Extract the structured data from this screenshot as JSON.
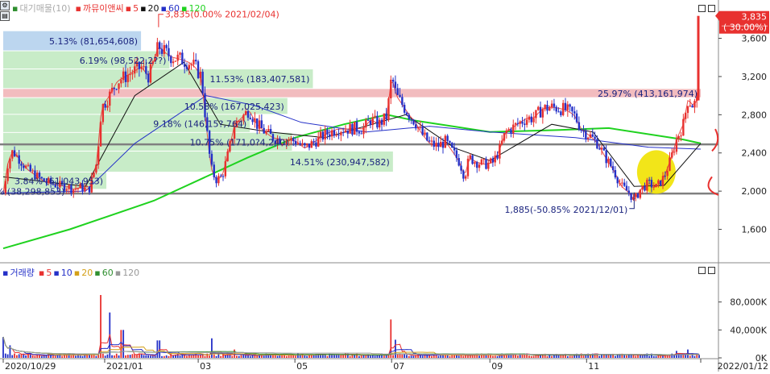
{
  "price_panel": {
    "legend": {
      "series_label": "대기매물(10)",
      "stock_name": "까뮤이앤씨",
      "ma_periods": [
        "5",
        "20",
        "60",
        "120"
      ]
    },
    "current_price_label": "3,835",
    "current_change_label": "( 30.00%)",
    "high_annotation": "3,835(0.00% 2021/02/04)",
    "low_annotation": "1,885(-50.85% 2021/12/01)"
  },
  "volume_panel": {
    "legend": {
      "series_label": "거래량",
      "ma_periods": [
        "5",
        "10",
        "20",
        "60",
        "120"
      ]
    }
  },
  "chart_data": [
    {
      "type": "candlestick",
      "title": "까뮤이앤씨",
      "y_ticks": [
        "3,600",
        "3,200",
        "2,800",
        "2,400",
        "2,000",
        "1,600"
      ],
      "y_tick_values": [
        3600,
        3200,
        2800,
        2400,
        2000,
        1600
      ],
      "ylim": [
        1250,
        3900
      ],
      "x_ticks": [
        "2020/10/29",
        "2021/01",
        "03",
        "05",
        "07",
        "09",
        "11",
        "2022/01/12"
      ],
      "x_start": "2020-10-29",
      "x_end": "2022-01-12",
      "x_tick_dates": [
        "2020-10-29",
        "2021-01-01",
        "2021-03-01",
        "2021-05-01",
        "2021-07-01",
        "2021-09-01",
        "2021-11-01",
        "2022-01-12"
      ],
      "horizontal_lines": [
        2490,
        1975
      ],
      "current_price": 3835,
      "current_change_pct": 30.0,
      "high": {
        "date": "2021-02-04",
        "price": 3835,
        "change_pct": 0.0
      },
      "low": {
        "date": "2021-12-01",
        "price": 1885,
        "change_pct": -50.85
      },
      "close_path": [
        [
          "2020-10-29",
          1980
        ],
        [
          "2020-11-01",
          2300
        ],
        [
          "2020-11-04",
          2420
        ],
        [
          "2020-11-09",
          2320
        ],
        [
          "2020-11-13",
          2230
        ],
        [
          "2020-11-18",
          2170
        ],
        [
          "2020-11-23",
          2110
        ],
        [
          "2020-11-28",
          2080
        ],
        [
          "2020-12-03",
          2060
        ],
        [
          "2020-12-08",
          2050
        ],
        [
          "2020-12-12",
          2020
        ],
        [
          "2020-12-17",
          2040
        ],
        [
          "2020-12-22",
          2010
        ],
        [
          "2020-12-27",
          2300
        ],
        [
          "2020-12-30",
          2870
        ],
        [
          "2021-01-04",
          3000
        ],
        [
          "2021-01-09",
          3150
        ],
        [
          "2021-01-14",
          3200
        ],
        [
          "2021-01-19",
          3250
        ],
        [
          "2021-01-24",
          3300
        ],
        [
          "2021-01-29",
          3200
        ],
        [
          "2021-02-04",
          3520
        ],
        [
          "2021-02-08",
          3450
        ],
        [
          "2021-02-13",
          3400
        ],
        [
          "2021-02-18",
          3380
        ],
        [
          "2021-02-23",
          3350
        ],
        [
          "2021-02-27",
          3300
        ],
        [
          "2021-03-03",
          3200
        ],
        [
          "2021-03-06",
          2700
        ],
        [
          "2021-03-09",
          2250
        ],
        [
          "2021-03-12",
          2120
        ],
        [
          "2021-03-16",
          2150
        ],
        [
          "2021-03-20",
          2400
        ],
        [
          "2021-03-24",
          2700
        ],
        [
          "2021-03-28",
          2760
        ],
        [
          "2021-04-02",
          2850
        ],
        [
          "2021-04-07",
          2700
        ],
        [
          "2021-04-12",
          2620
        ],
        [
          "2021-04-17",
          2560
        ],
        [
          "2021-04-22",
          2540
        ],
        [
          "2021-04-27",
          2540
        ],
        [
          "2021-05-02",
          2520
        ],
        [
          "2021-05-07",
          2450
        ],
        [
          "2021-05-12",
          2500
        ],
        [
          "2021-05-17",
          2560
        ],
        [
          "2021-05-22",
          2610
        ],
        [
          "2021-05-28",
          2650
        ],
        [
          "2021-06-03",
          2650
        ],
        [
          "2021-06-08",
          2660
        ],
        [
          "2021-06-13",
          2650
        ],
        [
          "2021-06-18",
          2750
        ],
        [
          "2021-06-23",
          2700
        ],
        [
          "2021-06-28",
          2780
        ],
        [
          "2021-07-01",
          3200
        ],
        [
          "2021-07-04",
          3000
        ],
        [
          "2021-07-08",
          2900
        ],
        [
          "2021-07-12",
          2800
        ],
        [
          "2021-07-16",
          2720
        ],
        [
          "2021-07-20",
          2600
        ],
        [
          "2021-07-25",
          2500
        ],
        [
          "2021-07-30",
          2470
        ],
        [
          "2021-08-04",
          2520
        ],
        [
          "2021-08-09",
          2400
        ],
        [
          "2021-08-13",
          2300
        ],
        [
          "2021-08-16",
          2150
        ],
        [
          "2021-08-19",
          2350
        ],
        [
          "2021-08-24",
          2300
        ],
        [
          "2021-08-29",
          2280
        ],
        [
          "2021-09-03",
          2300
        ],
        [
          "2021-09-07",
          2430
        ],
        [
          "2021-09-11",
          2620
        ],
        [
          "2021-09-15",
          2660
        ],
        [
          "2021-09-20",
          2720
        ],
        [
          "2021-09-24",
          2760
        ],
        [
          "2021-09-29",
          2770
        ],
        [
          "2021-10-04",
          2860
        ],
        [
          "2021-10-09",
          2880
        ],
        [
          "2021-10-14",
          2870
        ],
        [
          "2021-10-19",
          2850
        ],
        [
          "2021-10-24",
          2800
        ],
        [
          "2021-10-29",
          2640
        ],
        [
          "2021-11-03",
          2580
        ],
        [
          "2021-11-08",
          2500
        ],
        [
          "2021-11-13",
          2350
        ],
        [
          "2021-11-18",
          2220
        ],
        [
          "2021-11-23",
          2050
        ],
        [
          "2021-11-28",
          1980
        ],
        [
          "2021-12-01",
          1900
        ],
        [
          "2021-12-05",
          2020
        ],
        [
          "2021-12-10",
          2080
        ],
        [
          "2021-12-15",
          2040
        ],
        [
          "2021-12-20",
          2150
        ],
        [
          "2021-12-24",
          2330
        ],
        [
          "2021-12-28",
          2550
        ],
        [
          "2022-01-01",
          2700
        ],
        [
          "2022-01-04",
          2960
        ],
        [
          "2022-01-07",
          2900
        ],
        [
          "2022-01-10",
          2950
        ],
        [
          "2022-01-12",
          3835
        ]
      ],
      "ma120_path": [
        [
          "2020-10-29",
          1400
        ],
        [
          "2020-12-10",
          1600
        ],
        [
          "2021-02-01",
          1900
        ],
        [
          "2021-04-01",
          2350
        ],
        [
          "2021-05-01",
          2560
        ],
        [
          "2021-06-01",
          2700
        ],
        [
          "2021-06-28",
          2800
        ],
        [
          "2021-07-15",
          2740
        ],
        [
          "2021-09-01",
          2620
        ],
        [
          "2021-10-15",
          2640
        ],
        [
          "2021-11-15",
          2660
        ],
        [
          "2022-01-01",
          2540
        ],
        [
          "2022-01-12",
          2500
        ]
      ],
      "ma60_path": [
        [
          "2020-10-29",
          1980
        ],
        [
          "2020-12-20",
          2000
        ],
        [
          "2021-01-20",
          2500
        ],
        [
          "2021-03-06",
          3000
        ],
        [
          "2021-04-05",
          2900
        ],
        [
          "2021-05-05",
          2720
        ],
        [
          "2021-06-15",
          2620
        ],
        [
          "2021-07-25",
          2680
        ],
        [
          "2021-09-01",
          2620
        ],
        [
          "2021-10-25",
          2560
        ],
        [
          "2021-12-10",
          2460
        ],
        [
          "2022-01-12",
          2440
        ]
      ],
      "ma20_path": [
        [
          "2020-10-29",
          2150
        ],
        [
          "2020-12-20",
          2050
        ],
        [
          "2021-01-20",
          3000
        ],
        [
          "2021-02-20",
          3350
        ],
        [
          "2021-03-15",
          2700
        ],
        [
          "2021-04-15",
          2620
        ],
        [
          "2021-05-20",
          2560
        ],
        [
          "2021-07-10",
          2800
        ],
        [
          "2021-08-10",
          2450
        ],
        [
          "2021-09-01",
          2320
        ],
        [
          "2021-10-10",
          2700
        ],
        [
          "2021-11-05",
          2620
        ],
        [
          "2021-12-01",
          2050
        ],
        [
          "2021-12-20",
          2060
        ],
        [
          "2022-01-12",
          2500
        ]
      ],
      "volume_profile": [
        {
          "label": "5.13% (81,654,608)",
          "pct": 5.13
        },
        {
          "label": "6.19% (98,522,2??)",
          "pct": 6.19
        },
        {
          "label": "11.53% (183,407,581)",
          "pct": 11.53
        },
        {
          "label": "25.97% (413,161,974)",
          "pct": 25.97
        },
        {
          "label": "10.58% (167,025,423)",
          "pct": 10.58
        },
        {
          "label": "9.18% (146,15?,764)",
          "pct": 9.18
        },
        {
          "label": "10.75% (171,0?4,240)",
          "pct": 10.75
        },
        {
          "label": "14.51% (230,947,582)",
          "pct": 14.51
        },
        {
          "label": "3.84% (61,043,953)",
          "pct": 3.84
        },
        {
          "label": "2.41% (38,298,853)",
          "pct": 2.41
        }
      ],
      "volume_profile_bounds": [
        3675,
        3465,
        3275,
        3070,
        2975,
        2800,
        2610,
        2415,
        2195,
        2015,
        1980
      ],
      "highlight_zone": {
        "date": "2021-12-15",
        "price": 2200
      }
    },
    {
      "type": "bar",
      "title": "거래량",
      "y_ticks": [
        "80,000K",
        "40,000K",
        "0K"
      ],
      "y_tick_values": [
        80000,
        40000,
        0
      ],
      "ylim": [
        0,
        120000
      ],
      "volume_spikes": [
        [
          "2020-10-29",
          30000
        ],
        [
          "2020-11-02",
          18000
        ],
        [
          "2020-12-30",
          90000
        ],
        [
          "2021-01-04",
          65000
        ],
        [
          "2021-01-12",
          40000
        ],
        [
          "2021-02-04",
          25000
        ],
        [
          "2021-03-09",
          28000
        ],
        [
          "2021-03-24",
          12000
        ],
        [
          "2021-07-01",
          55000
        ],
        [
          "2021-07-04",
          26000
        ],
        [
          "2021-12-28",
          10000
        ],
        [
          "2022-01-04",
          12000
        ],
        [
          "2022-01-12",
          45000
        ]
      ]
    }
  ],
  "colors": {
    "up": "#e8312f",
    "down": "#2531c8",
    "ma5": "#e8312f",
    "ma20": "#111111",
    "ma60": "#2531c8",
    "ma120": "#1fd21f",
    "profile_normal": "#c8ecc8",
    "profile_top": "#bcd6ef",
    "profile_max": "#f2bcbf",
    "price_tag": "#e8312f",
    "highlight_zone": "#f1e200"
  }
}
